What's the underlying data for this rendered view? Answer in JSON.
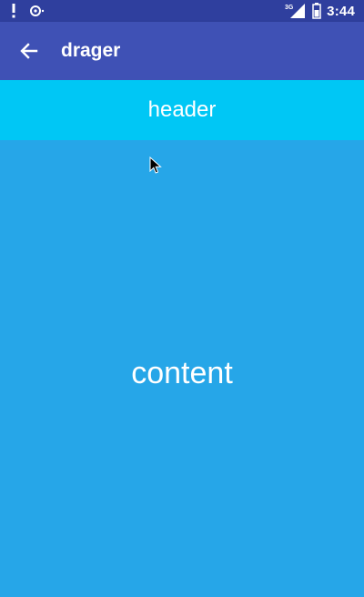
{
  "status_bar": {
    "time": "3:44",
    "network": "3G",
    "icons": [
      "alert-icon",
      "sync-icon",
      "signal-icon",
      "battery-icon"
    ]
  },
  "app_bar": {
    "title": "drager",
    "back_icon": "arrow-left-icon"
  },
  "header": {
    "label": "header"
  },
  "content": {
    "label": "content"
  },
  "colors": {
    "status_bar": "#2f3f9e",
    "app_bar": "#3f51b5",
    "header": "#00c7f5",
    "content": "#26a6e8"
  }
}
